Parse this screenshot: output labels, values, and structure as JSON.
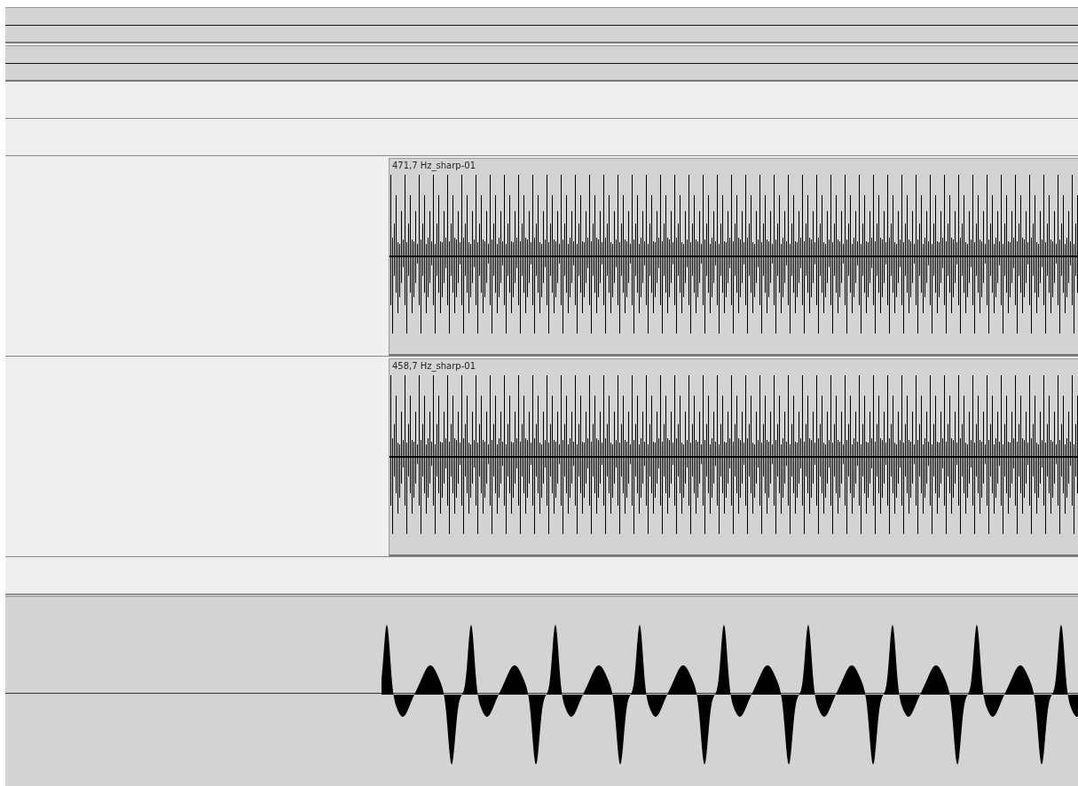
{
  "tracks": [
    {
      "clip": {
        "name": "471,7 Hz_sharp-01"
      }
    },
    {
      "clip": {
        "name": "458,7 Hz_sharp-01"
      }
    }
  ]
}
